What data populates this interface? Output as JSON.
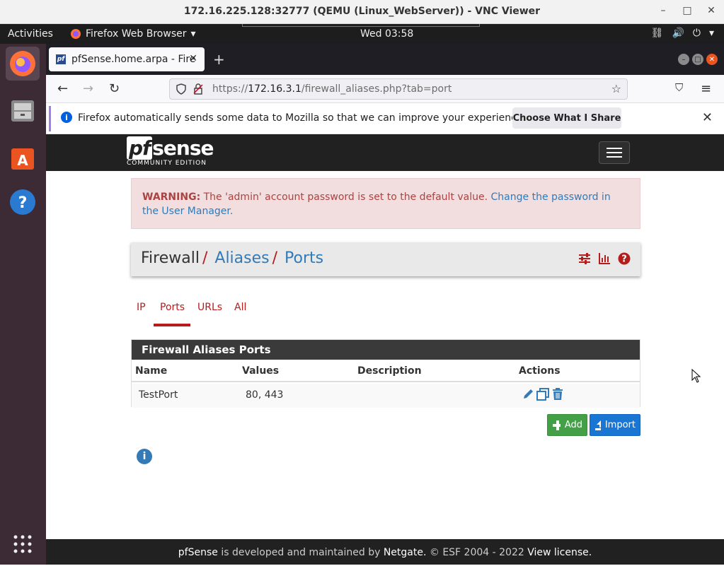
{
  "vnc": {
    "title": "172.16.225.128:32777 (QEMU (Linux_WebServer)) - VNC Viewer",
    "minimize": "–",
    "maximize": "□",
    "close": "✕"
  },
  "gnome": {
    "activities": "Activities",
    "app": "Firefox Web Browser",
    "clock": "Wed 03:58"
  },
  "browser": {
    "tab_title": "pfSense.home.arpa - Fire",
    "favicon": "pf",
    "url_proto": "https://",
    "url_host": "172.16.3.1",
    "url_path": "/firewall_aliases.php?tab=port",
    "notice_text": "Firefox automatically sends some data to Mozilla so that we can improve your experience.",
    "notice_button": "Choose What I Share"
  },
  "pfsense": {
    "logo_pf": "pf",
    "logo_sense": "sense",
    "logo_edition": "COMMUNITY EDITION",
    "warning_label": "WARNING:",
    "warning_text": " The 'admin' account password is set to the default value. ",
    "warning_link": "Change the password in the User Manager.",
    "breadcrumb": {
      "first": "Firewall",
      "sep1": "/",
      "second": "Aliases",
      "sep2": "/",
      "third": "Ports"
    },
    "tabs": [
      "IP",
      "Ports",
      "URLs",
      "All"
    ],
    "active_tab": "Ports",
    "panel_title": "Firewall Aliases Ports",
    "columns": [
      "Name",
      "Values",
      "Description",
      "Actions"
    ],
    "rows": [
      {
        "name": "TestPort",
        "values": "80, 443",
        "description": ""
      }
    ],
    "add_label": "Add",
    "import_label": "Import",
    "footer": {
      "brand": "pfSense",
      "mid": " is developed and maintained by ",
      "company": "Netgate.",
      "copy": " © ESF 2004 - 2022 ",
      "license": "View license."
    }
  },
  "colors": {
    "accent_red": "#b71c1c",
    "link_blue": "#337ab7",
    "add_green": "#43a047",
    "import_blue": "#1976d2"
  }
}
